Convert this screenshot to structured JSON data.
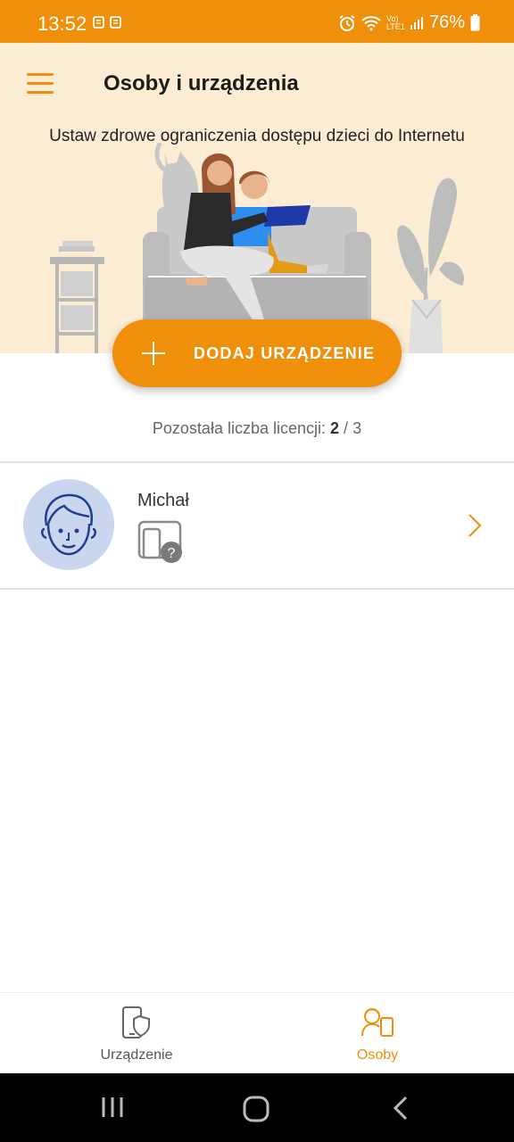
{
  "status_bar": {
    "time": "13:52",
    "network": "Vo) LTE1",
    "battery": "76%"
  },
  "header": {
    "title": "Osoby i urządzenia",
    "subtitle": "Ustaw zdrowe ograniczenia dostępu dzieci do Internetu"
  },
  "add_button": {
    "label": "DODAJ URZĄDZENIE",
    "icon": "plus-icon"
  },
  "licenses": {
    "label": "Pozostała liczba licencji:",
    "used": "2",
    "separator": "/",
    "total": "3"
  },
  "people": [
    {
      "name": "Michał",
      "device_status": "unknown-device-icon"
    }
  ],
  "bottom_nav": {
    "items": [
      {
        "label": "Urządzenie",
        "icon": "phone-shield-icon",
        "active": false
      },
      {
        "label": "Osoby",
        "icon": "person-device-icon",
        "active": true
      }
    ]
  },
  "colors": {
    "accent": "#f0900a",
    "header_bg": "#fdecd4",
    "avatar_bg": "#c9d6ee",
    "avatar_line": "#1f3f93",
    "inactive_text": "#555555"
  }
}
